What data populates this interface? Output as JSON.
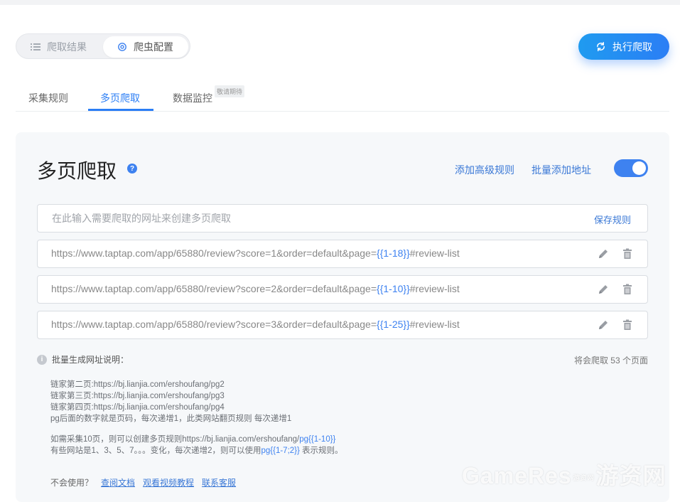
{
  "segment": {
    "results_label": "爬取结果",
    "config_label": "爬虫配置"
  },
  "run_button": {
    "label": "执行爬取"
  },
  "tabs": [
    {
      "label": "采集规则"
    },
    {
      "label": "多页爬取"
    },
    {
      "label": "数据监控"
    }
  ],
  "tab_badge": "敬请期待",
  "panel": {
    "title": "多页爬取",
    "help": "?",
    "add_advanced_rule": "添加高级规则",
    "batch_add_url": "批量添加地址",
    "toggle_on": true
  },
  "url_input": {
    "placeholder": "在此输入需要爬取的网址来创建多页爬取",
    "value": "",
    "save_label": "保存规则"
  },
  "rules": [
    {
      "prefix": "https://www.taptap.com/app/65880/review?score=1&order=default&page=",
      "var": "{{1-18}}",
      "suffix": "#review-list"
    },
    {
      "prefix": "https://www.taptap.com/app/65880/review?score=2&order=default&page=",
      "var": "{{1-10}}",
      "suffix": "#review-list"
    },
    {
      "prefix": "https://www.taptap.com/app/65880/review?score=3&order=default&page=",
      "var": "{{1-25}}",
      "suffix": "#review-list"
    }
  ],
  "notes": {
    "heading": "批量生成网址说明：",
    "page_count": "将会爬取 53 个页面",
    "lines1": [
      "链家第二页:https://bj.lianjia.com/ershoufang/pg2",
      "链家第三页:https://bj.lianjia.com/ershoufang/pg3",
      "链家第四页:https://bj.lianjia.com/ershoufang/pg4",
      "pg后面的数字就是页码，每次递增1，此类网站翻页规则 每次递增1"
    ],
    "example1_prefix": "如需采集10页，则可以创建多页规则https://bj.lianjia.com/ershoufang/",
    "example1_var": "pg{{1-10}}",
    "example2_prefix": "有些网站是1、3、5、7。。。变化，每次递增2，则可以使用",
    "example2_var": "pg{{1-7;2}}",
    "example2_suffix": " 表示规则。"
  },
  "footer": {
    "question": "不会使用？",
    "links": [
      "查阅文档",
      "观看视频教程",
      "联系客服"
    ]
  },
  "watermark": {
    "latin": "GameRes",
    "small": "游资网",
    "cjk": "游资网"
  },
  "colors": {
    "accent": "#2b7ef5",
    "link": "#3a78d6",
    "panel_bg": "#f6f8fa"
  }
}
